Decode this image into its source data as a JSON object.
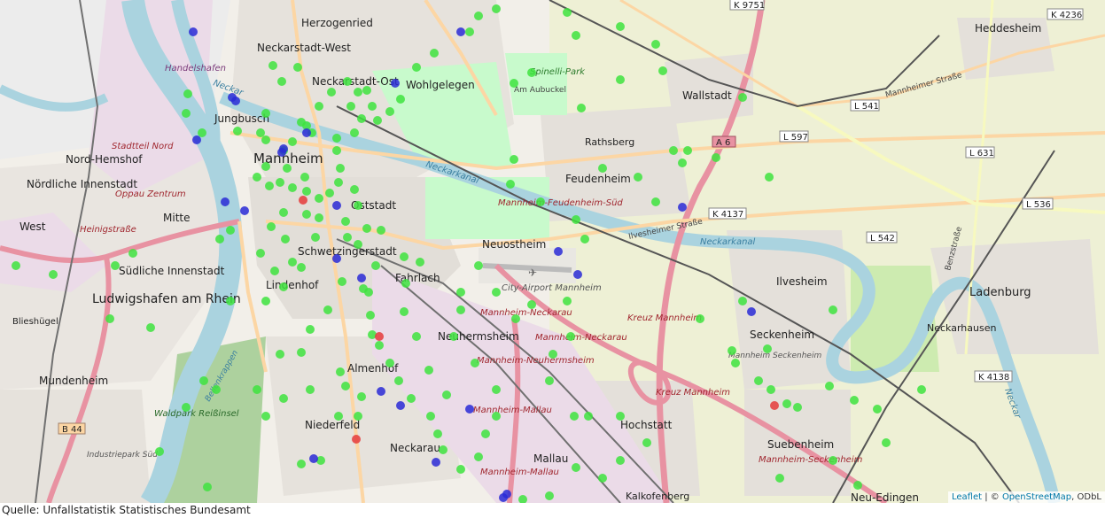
{
  "map": {
    "labels": {
      "herzogenried": "Herzogenried",
      "neckarstadt_west": "Neckarstadt-West",
      "neckarstadt_ost": "Neckarstadt-Ost",
      "wohlgelegen": "Wohlgelegen",
      "spinelli": "Spinelli-Park",
      "am_aubuckel": "Am Aubuckel",
      "wallstadt": "Wallstadt",
      "heddesheim": "Heddesheim",
      "handelshafen": "Handelshafen",
      "jungbusch": "Jungbusch",
      "mannheim": "Mannheim",
      "rathsberg": "Rathsberg",
      "nord_hemshof": "Nord-Hemshof",
      "noerdliche_innenstadt": "Nördliche Innenstadt",
      "stadtteil_nord": "Stadtteil Nord",
      "oppau_zentrum": "Oppau Zentrum",
      "mitte": "Mitte",
      "west": "West",
      "heinigstrasse": "Heinigstraße",
      "oststadt": "Oststadt",
      "feudenheim": "Feudenheim",
      "mannheim_feudenheim_sued": "Mannheim-Feudenheim-Süd",
      "neuostheim": "Neuostheim",
      "schwetzingerstadt": "Schwetzingerstadt",
      "fahrlach": "Fahrlach",
      "suedliche_innenstadt": "Südliche Innenstadt",
      "lindenhof": "Lindenhof",
      "ludwigshafen": "Ludwigshafen am Rhein",
      "blieshuegel": "Blieshügel",
      "city_airport": "City-Airport Mannheim",
      "mannheim_neckarau": "Mannheim-Neckarau",
      "neuhermsheim": "Neuhermsheim",
      "mannheim_neuhermsheim": "Mannheim-Neuhermsheim",
      "kreuz_mannheim": "Kreuz Mannheim",
      "ilvesheim": "Ilvesheim",
      "ladenburg": "Ladenburg",
      "neckarhausen": "Neckarhausen",
      "seckenheim": "Seckenheim",
      "mannheim_seckenheim": "Mannheim Seckenheim",
      "mundenheim": "Mundenheim",
      "almenhof": "Almenhof",
      "niederfeld": "Niederfeld",
      "waldpark": "Waldpark Reißinsel",
      "industriepark": "Industriepark Süd",
      "mannheim_mallau": "Mannheim-Mallau",
      "hochstatt": "Hochstatt",
      "suebenheim": "Suebenheim",
      "mannheim_seckenheim_station": "Mannheim-Seckenheim",
      "neckarau": "Neckarau",
      "mallau": "Mallau",
      "kalkofenberg": "Kalkofenberg",
      "neu_edingen": "Neu-Edingen",
      "neckarkanal": "Neckarkanal",
      "neckar": "Neckar",
      "bellenkrappen": "Bellenkrappen"
    },
    "road_refs": {
      "k9751": "K 9751",
      "k4236": "K 4236",
      "l541": "L 541",
      "a6": "A 6",
      "l597": "L 597",
      "l631": "L 631",
      "k4137": "K 4137",
      "l536": "L 536",
      "l542": "L 542",
      "k4138": "K 4138",
      "b44": "B 44"
    },
    "street_names": {
      "mannheimer_strasse": "Mannheimer Straße",
      "ilvesheimer_strasse": "Ilvesheimer Straße",
      "benzstrasse": "Benzstraße"
    },
    "colors": {
      "green_marker": "#3ee33e",
      "blue_marker": "#2a2ad6",
      "red_marker": "#e53b3b",
      "water": "#aad3df",
      "motorway": "#e892a2",
      "primary": "#fcd6a4",
      "farmland": "#eef0d5"
    }
  },
  "attribution": {
    "leaflet": "Leaflet",
    "separator": " | © ",
    "osm": "OpenStreetMap",
    "odbl": ", ODbL"
  },
  "source_note": "Quelle: Unfallstatistik Statistisches Bundesamt"
}
